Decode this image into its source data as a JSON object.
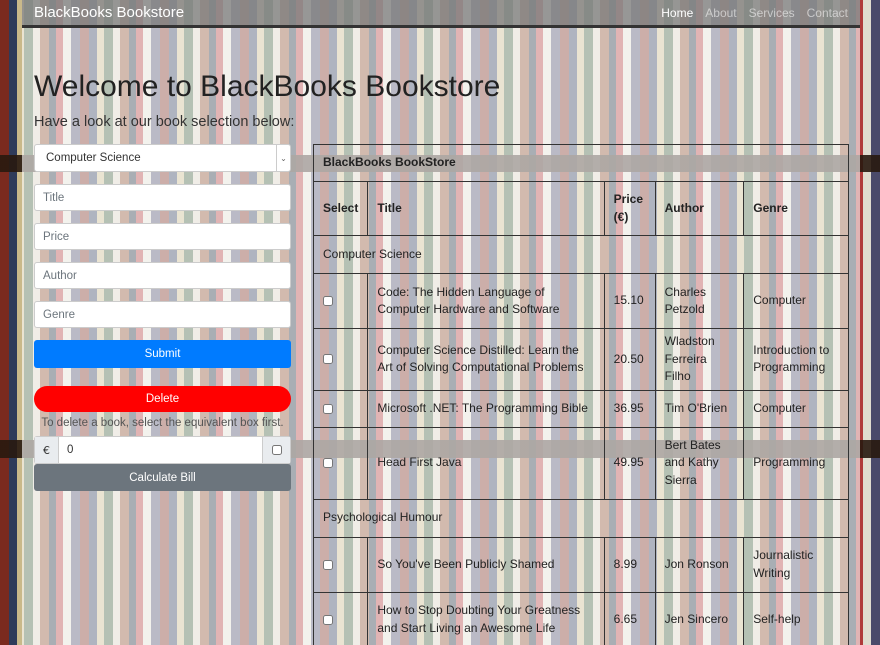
{
  "navbar": {
    "brand": "BlackBooks Bookstore",
    "links": [
      "Home",
      "About",
      "Services",
      "Contact"
    ]
  },
  "page": {
    "title": "Welcome to BlackBooks Bookstore",
    "subtitle": "Have a look at our book selection below:"
  },
  "form": {
    "category_selected": "Computer Science",
    "title_placeholder": "Title",
    "price_placeholder": "Price",
    "author_placeholder": "Author",
    "genre_placeholder": "Genre",
    "submit_label": "Submit",
    "delete_label": "Delete",
    "delete_hint": "To delete a book, select the equivalent box first.",
    "currency_symbol": "€",
    "bill_value": "0",
    "calculate_label": "Calculate Bill"
  },
  "table": {
    "caption": "BlackBooks BookStore",
    "headers": [
      "Select",
      "Title",
      "Price (€)",
      "Author",
      "Genre"
    ],
    "categories": [
      {
        "name": "Computer Science",
        "books": [
          {
            "title": "Code: The Hidden Language of Computer Hardware and Software",
            "price": "15.10",
            "author": "Charles Petzold",
            "genre": "Computer"
          },
          {
            "title": "Computer Science Distilled: Learn the Art of Solving Computational Problems",
            "price": "20.50",
            "author": "Wladston Ferreira Filho",
            "genre": "Introduction to Programming"
          },
          {
            "title": "Microsoft .NET: The Programming Bible",
            "price": "36.95",
            "author": "Tim O'Brien",
            "genre": "Computer"
          },
          {
            "title": "Head First Java",
            "price": "49.95",
            "author": "Bert Bates and Kathy Sierra",
            "genre": "Programming"
          }
        ]
      },
      {
        "name": "Psychological Humour",
        "books": [
          {
            "title": "So You've Been Publicly Shamed",
            "price": "8.99",
            "author": "Jon Ronson",
            "genre": "Journalistic Writing"
          },
          {
            "title": "How to Stop Doubting Your Greatness and Start Living an Awesome Life",
            "price": "6.65",
            "author": "Jen Sincero",
            "genre": "Self-help"
          }
        ]
      }
    ]
  },
  "colors": {
    "primary": "#007bff",
    "danger": "#ff0000",
    "secondary": "#6c757d"
  }
}
